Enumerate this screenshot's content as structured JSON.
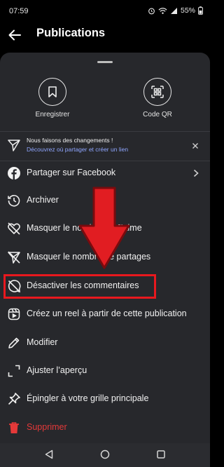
{
  "status": {
    "time": "07:59",
    "battery": "55%"
  },
  "header": {
    "title": "Publications"
  },
  "top_actions": [
    {
      "label": "Enregistrer",
      "icon": "bookmark-icon"
    },
    {
      "label": "Code QR",
      "icon": "qr-code-icon"
    }
  ],
  "notice": {
    "title": "Nous faisons des changements !",
    "link": "Découvrez où partager et créer un lien"
  },
  "menu": {
    "items": [
      {
        "label": "Partager sur Facebook",
        "icon": "facebook-icon"
      },
      {
        "label": "Archiver",
        "icon": "archive-icon"
      },
      {
        "label": "Masquer le nombre de J’aime",
        "icon": "heart-slash-icon"
      },
      {
        "label": "Masquer le nombre de partages",
        "icon": "send-slash-icon"
      },
      {
        "label": "Désactiver les commentaires",
        "icon": "comment-slash-icon"
      },
      {
        "label": "Créez un reel à partir de cette publication",
        "icon": "reel-icon"
      },
      {
        "label": "Modifier",
        "icon": "pencil-icon"
      },
      {
        "label": "Ajuster l’aperçu",
        "icon": "crop-icon"
      },
      {
        "label": "Épingler à votre grille principale",
        "icon": "pin-icon"
      },
      {
        "label": "Supprimer",
        "icon": "trash-icon"
      }
    ]
  },
  "colors": {
    "highlight": "#e8181e",
    "danger": "#e53939",
    "link": "#8fa6ff",
    "sheet": "#27282c"
  }
}
